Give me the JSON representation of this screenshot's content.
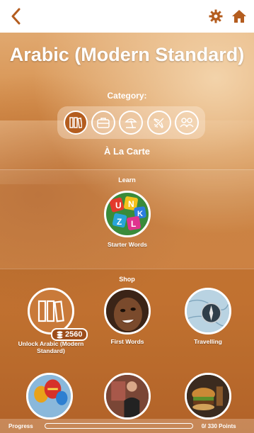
{
  "header": {
    "back_icon": "chevron-left-icon",
    "settings_icon": "gear-icon",
    "home_icon": "home-icon",
    "accent": "#b45d1f"
  },
  "title": "Arabic (Modern Standard)",
  "category": {
    "label": "Category:",
    "selected_name": "À La Carte",
    "buttons": [
      {
        "icon": "books-icon",
        "active": true
      },
      {
        "icon": "briefcase-icon",
        "active": false
      },
      {
        "icon": "beach-umbrella-icon",
        "active": false
      },
      {
        "icon": "airplane-icon",
        "active": false
      },
      {
        "icon": "people-icon",
        "active": false
      }
    ]
  },
  "learn": {
    "title": "Learn",
    "items": [
      {
        "label": "Starter Words",
        "icon": "letter-blocks-image"
      }
    ]
  },
  "shop": {
    "title": "Shop",
    "items": [
      {
        "label": "Unlock Arabic (Modern Standard)",
        "price": "2560",
        "icon": "books-icon"
      },
      {
        "label": "First Words",
        "icon": "child-face-image"
      },
      {
        "label": "Travelling",
        "icon": "compass-map-image"
      },
      {
        "label": "",
        "icon": "hot-air-balloons-image"
      },
      {
        "label": "",
        "icon": "restaurant-image"
      },
      {
        "label": "",
        "icon": "burger-image"
      }
    ]
  },
  "progress": {
    "label": "Progress",
    "value": 0,
    "points": "0/ 330 Points"
  }
}
